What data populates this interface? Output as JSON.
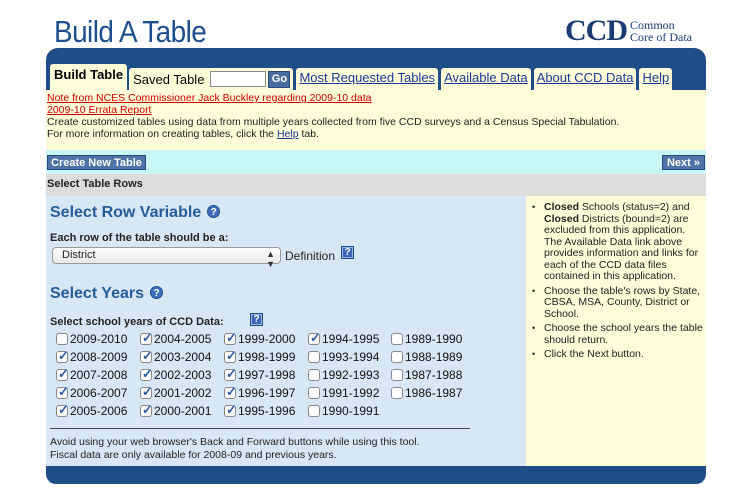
{
  "header": {
    "title": "Build A Table",
    "logo_main": "CCD",
    "logo_line1": "Common",
    "logo_line2": "Core of Data"
  },
  "nav": {
    "active_tab": "Build Table",
    "saved_label": "Saved Table",
    "saved_input_value": "",
    "go_label": "Go",
    "links": [
      "Most Requested Tables",
      "Available Data",
      "About CCD Data",
      "Help"
    ]
  },
  "notice": {
    "link1": "Note from NCES Commissioner Jack Buckley regarding 2009-10 data",
    "link2": "2009-10 Errata Report",
    "line1": "Create customized tables using data from multiple years collected from five CCD surveys and a Census Special Tabulation.",
    "line2_pre": "For more information on creating tables, click the ",
    "line2_link": "Help",
    "line2_post": " tab."
  },
  "actions": {
    "create_label": "Create New Table",
    "next_label": "Next »"
  },
  "section_title": "Select Table Rows",
  "row_variable": {
    "heading": "Select Row Variable",
    "prompt": "Each row of the table should be a:",
    "selected": "District",
    "definition_label": "Definition"
  },
  "years_section": {
    "heading": "Select Years",
    "prompt": "Select school years of CCD Data:",
    "years": [
      {
        "label": "2009-2010",
        "checked": false
      },
      {
        "label": "2004-2005",
        "checked": true
      },
      {
        "label": "1999-2000",
        "checked": true
      },
      {
        "label": "1994-1995",
        "checked": true
      },
      {
        "label": "1989-1990",
        "checked": false
      },
      {
        "label": "2008-2009",
        "checked": true
      },
      {
        "label": "2003-2004",
        "checked": true
      },
      {
        "label": "1998-1999",
        "checked": true
      },
      {
        "label": "1993-1994",
        "checked": false
      },
      {
        "label": "1988-1989",
        "checked": false
      },
      {
        "label": "2007-2008",
        "checked": true
      },
      {
        "label": "2002-2003",
        "checked": true
      },
      {
        "label": "1997-1998",
        "checked": true
      },
      {
        "label": "1992-1993",
        "checked": false
      },
      {
        "label": "1987-1988",
        "checked": false
      },
      {
        "label": "2006-2007",
        "checked": true
      },
      {
        "label": "2001-2002",
        "checked": true
      },
      {
        "label": "1996-1997",
        "checked": true
      },
      {
        "label": "1991-1992",
        "checked": false
      },
      {
        "label": "1986-1987",
        "checked": false
      },
      {
        "label": "2005-2006",
        "checked": true
      },
      {
        "label": "2000-2001",
        "checked": true
      },
      {
        "label": "1995-1996",
        "checked": true
      },
      {
        "label": "1990-1991",
        "checked": false
      }
    ]
  },
  "footnotes": {
    "line1": "Avoid using your web browser's Back and Forward buttons while using this tool.",
    "line2": "Fiscal data are only available for 2008-09 and previous years."
  },
  "sidebar": {
    "item1_bold1": "Closed",
    "item1_text1": " Schools (status=2) and ",
    "item1_bold2": "Closed",
    "item1_text2": " Districts (bound=2) are excluded from this application. The Available Data link above provides information and links for each of the CCD data files contained in this application.",
    "item2": "Choose the table's rows by State, CBSA, MSA, County, District or School.",
    "item3": "Choose the school years the table should return.",
    "item4": "Click the Next button."
  },
  "colors": {
    "navy": "#1e4d87",
    "cream": "#fdfbd8",
    "cyan": "#c7f7f5",
    "panel_blue": "#d8e7f6",
    "heading_blue": "#255c9a",
    "link_red": "#d00000"
  },
  "icons": [
    "help-circle-icon",
    "help-square-icon",
    "select-arrow-icon",
    "checkbox-icon"
  ]
}
